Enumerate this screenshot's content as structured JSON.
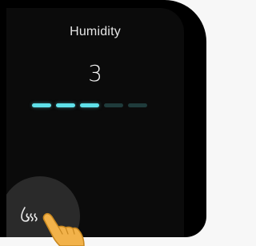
{
  "screen": {
    "title": "Humidity",
    "value": "3",
    "level": {
      "current": 3,
      "max": 5
    }
  },
  "icons": {
    "mode": "humidity-icon",
    "pointer": "hand-pointer-icon"
  },
  "colors": {
    "accent": "#5fe1ea",
    "inactive": "#1f3b3b",
    "background": "#0b0b0b"
  }
}
